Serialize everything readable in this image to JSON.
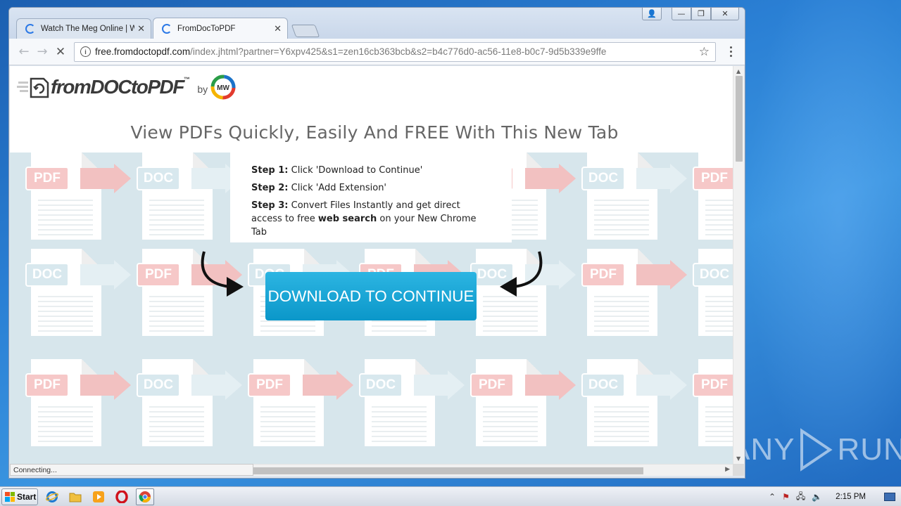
{
  "browser": {
    "tabs": [
      {
        "title": "Watch The Meg Online | Wa",
        "loading": true
      },
      {
        "title": "FromDocToPDF",
        "loading": true,
        "active": true
      }
    ],
    "url_host": "free.fromdoctopdf.com",
    "url_path": "/index.jhtml?partner=Y6xpv425&s1=zen16cb363bcb&s2=b4c776d0-ac56-11e8-b0c7-9d5b339e9ffe",
    "status": "Connecting..."
  },
  "page": {
    "logo_text": "fromDOCtoPDF",
    "logo_tm": "™",
    "logo_by": "by",
    "logo_mw": "MW",
    "headline": "View PDFs Quickly, Easily And FREE With This New Tab",
    "steps": [
      {
        "label": "Step 1:",
        "text": "Click 'Download to Continue'"
      },
      {
        "label": "Step 2:",
        "text": "Click 'Add Extension'"
      },
      {
        "label": "Step 3:",
        "text_before": "Convert Files Instantly and get direct access to free ",
        "bold": "web search",
        "text_after": " on your New Chrome Tab"
      }
    ],
    "cta_label": "DOWNLOAD TO CONTINUE",
    "badge_pdf": "PDF",
    "badge_doc": "DOC"
  },
  "taskbar": {
    "start_label": "Start",
    "clock": "2:15 PM",
    "apps": [
      "internet-explorer-icon",
      "explorer-folder-icon",
      "media-player-icon",
      "opera-icon",
      "chrome-icon"
    ]
  },
  "watermark": {
    "left": "ANY",
    "right": "RUN"
  },
  "colors": {
    "cta": "#0fa0d2",
    "pattern_bg": "#d7e6ec",
    "pdf_badge": "#f6c8c8"
  }
}
